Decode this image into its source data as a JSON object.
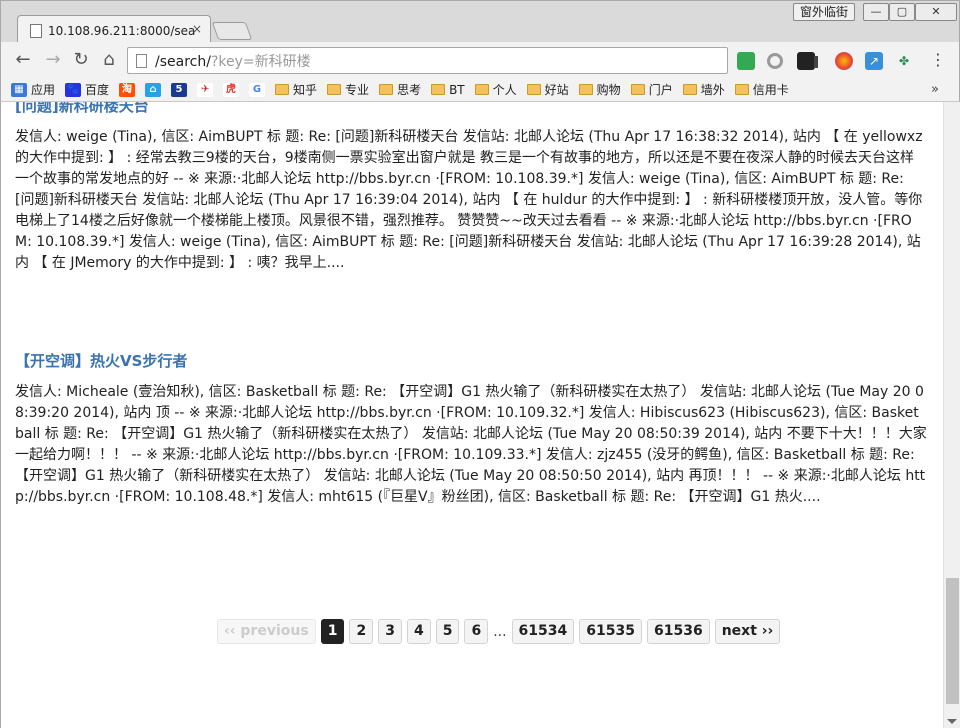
{
  "browser": {
    "tab_title": "10.108.96.211:8000/sea",
    "tab_close": "×",
    "profile_button": "窗外临街",
    "window_controls": {
      "minimize": "—",
      "maximize": "▢",
      "close": "✕"
    },
    "nav": {
      "back": "←",
      "forward": "→",
      "reload": "↻",
      "home": "⌂"
    },
    "url_path": "/search/",
    "url_query": "?key=新科研楼",
    "menu": "⋮"
  },
  "bookmarks": {
    "items": [
      {
        "label": "应用",
        "icon": "apps-icon",
        "color": "#3c78d8"
      },
      {
        "label": "百度",
        "icon": "baidu-icon",
        "color": "#2932e1"
      },
      {
        "label": "",
        "icon": "taobao-icon",
        "color": "#ff5000"
      },
      {
        "label": "",
        "icon": "home-icon",
        "color": "#2aa1e6"
      },
      {
        "label": "",
        "icon": "five-icon",
        "color": "#1a3c8e"
      },
      {
        "label": "",
        "icon": "bird-icon",
        "color": "#c0282d"
      },
      {
        "label": "",
        "icon": "tiger-icon",
        "color": "#e23a2e"
      },
      {
        "label": "",
        "icon": "google-icon",
        "color": "#4285f4"
      }
    ],
    "folders": [
      "知乎",
      "专业",
      "思考",
      "BT",
      "个人",
      "好站",
      "购物",
      "门户",
      "墙外",
      "信用卡"
    ],
    "more": "»"
  },
  "results": [
    {
      "title": "[问题]新科研楼天台",
      "snippet": "发信人: weige (Tina), 信区: AimBUPT 标  题: Re: [问题]新科研楼天台 发信站: 北邮人论坛 (Thu Apr 17 16:38:32 2014), 站内 【 在 yellowxz 的大作中提到: 】 : 经常去教三9楼的天台，9楼南侧一票实验室出窗户就是 教三是一个有故事的地方，所以还是不要在夜深人静的时候去天台这样一个故事的常发地点的好 -- ※ 来源:·北邮人论坛 http://bbs.byr.cn ·[FROM: 10.108.39.*] 发信人: weige (Tina), 信区: AimBUPT 标  题: Re: [问题]新科研楼天台 发信站: 北邮人论坛 (Thu Apr 17 16:39:04 2014), 站内 【 在 huldur 的大作中提到: 】 : 新科研楼楼顶开放，没人管。等你电梯上了14楼之后好像就一个楼梯能上楼顶。风景很不错，强烈推荐。 赞赞赞~~改天过去看看 -- ※ 来源:·北邮人论坛 http://bbs.byr.cn ·[FROM: 10.108.39.*] 发信人: weige (Tina), 信区: AimBUPT 标  题: Re: [问题]新科研楼天台 发信站: 北邮人论坛 (Thu Apr 17 16:39:28 2014), 站内 【 在 JMemory 的大作中提到: 】 : 咦？我早上...."
    },
    {
      "title": "【开空调】热火VS步行者",
      "snippet": "发信人: Micheale (壹治知秋), 信区: Basketball 标  题: Re: 【开空调】G1 热火输了（新科研楼实在太热了） 发信站: 北邮人论坛 (Tue May 20 08:39:20 2014), 站内 顶 -- ※ 来源:·北邮人论坛 http://bbs.byr.cn ·[FROM: 10.109.32.*] 发信人: Hibiscus623 (Hibiscus623), 信区: Basketball 标  题: Re: 【开空调】G1 热火输了（新科研楼实在太热了） 发信站: 北邮人论坛 (Tue May 20 08:50:39 2014), 站内 不要下十大！！！大家一起给力啊！！！ -- ※ 来源:·北邮人论坛 http://bbs.byr.cn ·[FROM: 10.109.33.*] 发信人: zjz455 (没牙的鳄鱼), 信区: Basketball 标  题: Re: 【开空调】G1 热火输了（新科研楼实在太热了） 发信站: 北邮人论坛 (Tue May 20 08:50:50 2014), 站内 再顶！！！ -- ※ 来源:·北邮人论坛 http://bbs.byr.cn ·[FROM: 10.108.48.*] 发信人: mht615 (『巨星V』粉丝团), 信区: Basketball 标  题: Re: 【开空调】G1 热火...."
    }
  ],
  "pagination": {
    "previous": "‹‹ previous",
    "pages": [
      "1",
      "2",
      "3",
      "4",
      "5",
      "6"
    ],
    "active": "1",
    "gap": "...",
    "tail_pages": [
      "61534",
      "61535",
      "61536"
    ],
    "next": "next ››"
  }
}
